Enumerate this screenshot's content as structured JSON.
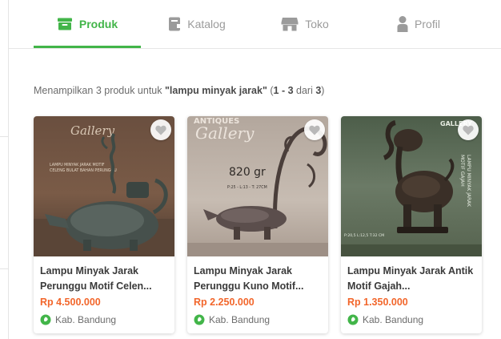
{
  "tabs": [
    {
      "label": "Produk",
      "icon": "store-icon",
      "active": true
    },
    {
      "label": "Katalog",
      "icon": "catalog-icon",
      "active": false
    },
    {
      "label": "Toko",
      "icon": "shop-icon",
      "active": false
    },
    {
      "label": "Profil",
      "icon": "user-icon",
      "active": false
    }
  ],
  "summary": {
    "prefix": "Menampilkan 3 produk untuk ",
    "query": "\"lampu minyak jarak\"",
    "range_open": " (",
    "range_from": "1",
    "range_sep": " - ",
    "range_to": "3",
    "range_of": " dari ",
    "total": "3",
    "range_close": ")"
  },
  "colors": {
    "accent": "#42b549",
    "price": "#f2662b"
  },
  "products": [
    {
      "name": "Lampu Minyak Jarak Perunggu Motif Celen...",
      "price": "Rp 4.500.000",
      "location": "Kab. Bandung",
      "photo_text": [
        "Gallery",
        "LAMPU MINYAK JARAK MOTIF",
        "CELENG BULAT BAHAN PERUNGGU"
      ]
    },
    {
      "name": "Lampu Minyak Jarak Perunggu Kuno Motif...",
      "price": "Rp 2.250.000",
      "location": "Kab. Bandung",
      "photo_text": [
        "ANTIQUES",
        "Gallery",
        "820 gr",
        "P:25 - L:13 - T: 27CM"
      ]
    },
    {
      "name": "Lampu Minyak Jarak Antik Motif Gajah...",
      "price": "Rp 1.350.000",
      "location": "Kab. Bandung",
      "photo_text": [
        "GALLERY",
        "LAMPU MINYAK JARAK",
        "MOTIF GAJAH",
        "P:20,5 L:12,5 T:32 CM"
      ]
    }
  ]
}
